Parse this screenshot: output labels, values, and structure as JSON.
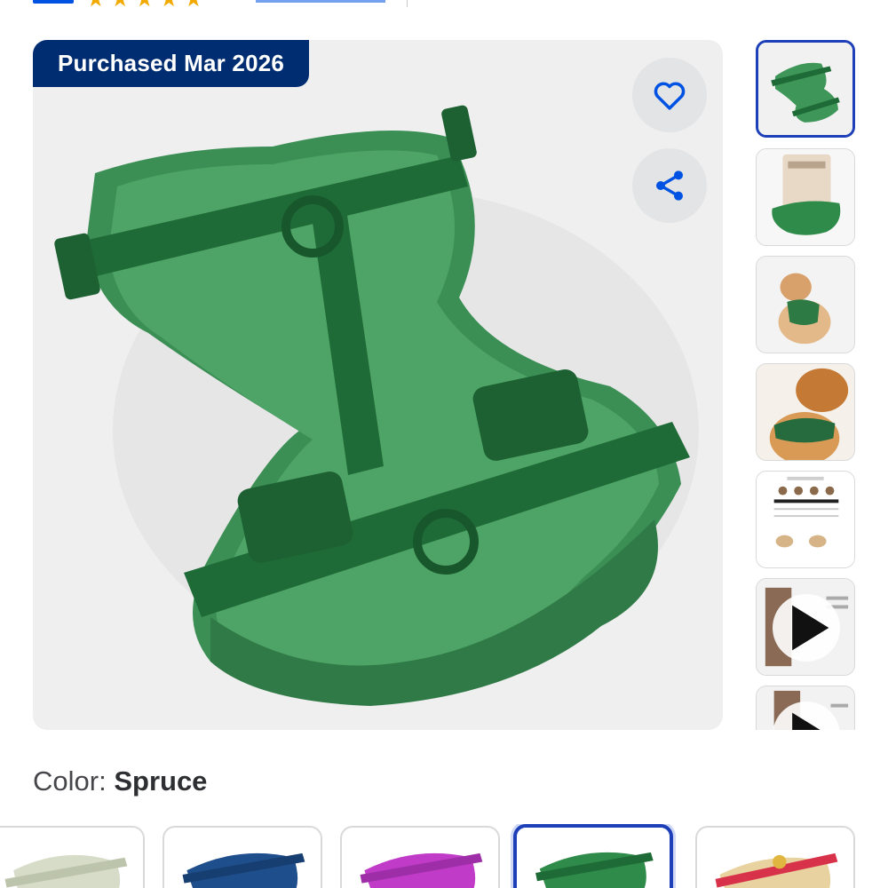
{
  "header": {
    "rating_stars": [
      "★",
      "★",
      "★",
      "★",
      "★"
    ]
  },
  "product_image": {
    "badge": "Purchased Mar 2026",
    "favorite_icon": "heart-icon",
    "share_icon": "share-icon",
    "accent_color": "#0053e2",
    "badge_color": "#002d72"
  },
  "thumbnails": [
    {
      "kind": "image",
      "depicts": "green harness",
      "selected": true
    },
    {
      "kind": "image",
      "depicts": "harness with packaging",
      "selected": false
    },
    {
      "kind": "image",
      "depicts": "pomeranian wearing harness",
      "selected": false
    },
    {
      "kind": "image",
      "depicts": "dog wearing harness close-up",
      "selected": false
    },
    {
      "kind": "image",
      "depicts": "size guide chart",
      "selected": false
    },
    {
      "kind": "video",
      "depicts": "video thumbnail",
      "play_icon": "play-icon",
      "selected": false
    },
    {
      "kind": "video",
      "depicts": "video thumbnail",
      "play_icon": "play-icon",
      "selected": false
    }
  ],
  "color_selector": {
    "label": "Color:",
    "selected_value": "Spruce",
    "swatches": [
      {
        "color_name_visible": false,
        "color": "#d6dcc8",
        "selected": false
      },
      {
        "color_name_visible": false,
        "color": "#1f4e8c",
        "selected": false
      },
      {
        "color_name_visible": false,
        "color": "#c03cc8",
        "selected": false
      },
      {
        "color_name_visible": false,
        "color": "#2e8b4a",
        "selected": true
      },
      {
        "color_name_visible": false,
        "color": "#e8d3a0",
        "selected": false
      }
    ]
  }
}
